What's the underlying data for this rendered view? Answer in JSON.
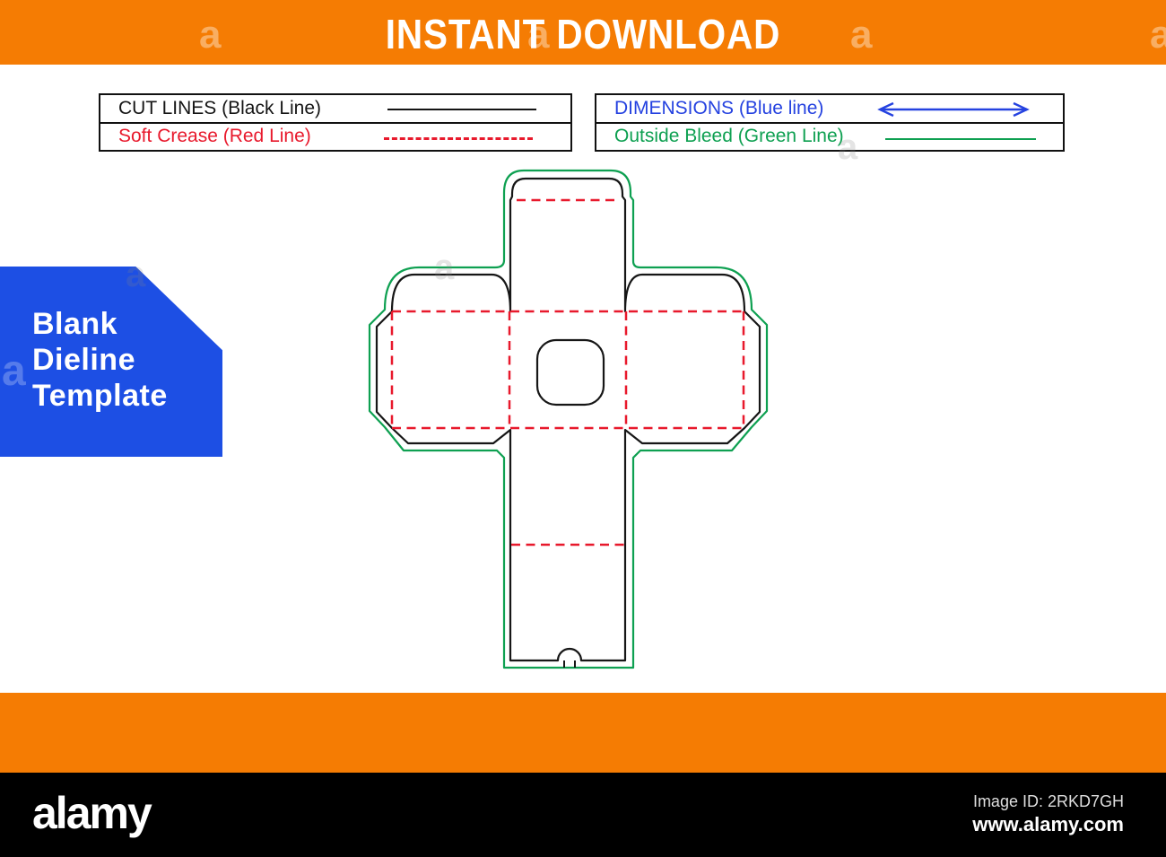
{
  "header": {
    "title": "INSTANT DOWNLOAD"
  },
  "legend_left": {
    "rows": [
      {
        "label": "CUT LINES (Black Line)",
        "sample": "solid-black-line"
      },
      {
        "label": "Soft Crease (Red Line)",
        "sample": "dashed-red-line"
      }
    ]
  },
  "legend_right": {
    "rows": [
      {
        "label": "DIMENSIONS (Blue line)",
        "sample": "blue-double-arrow"
      },
      {
        "label": "Outside Bleed (Green Line)",
        "sample": "solid-green-line"
      }
    ]
  },
  "side_label": {
    "lines": [
      "Blank",
      "Dieline",
      "Template"
    ]
  },
  "alamy_bar": {
    "logo": "alamy",
    "image_id": "Image ID: 2RKD7GH",
    "site": "www.alamy.com"
  },
  "watermark": {
    "glyph": "a"
  },
  "colors": {
    "orange": "#f57c03",
    "badge_blue": "#1d4fe4",
    "dimension_blue": "#2542e0",
    "bleed_green": "#0ea051",
    "crease_red": "#e8192c",
    "cut_black": "#161616"
  }
}
